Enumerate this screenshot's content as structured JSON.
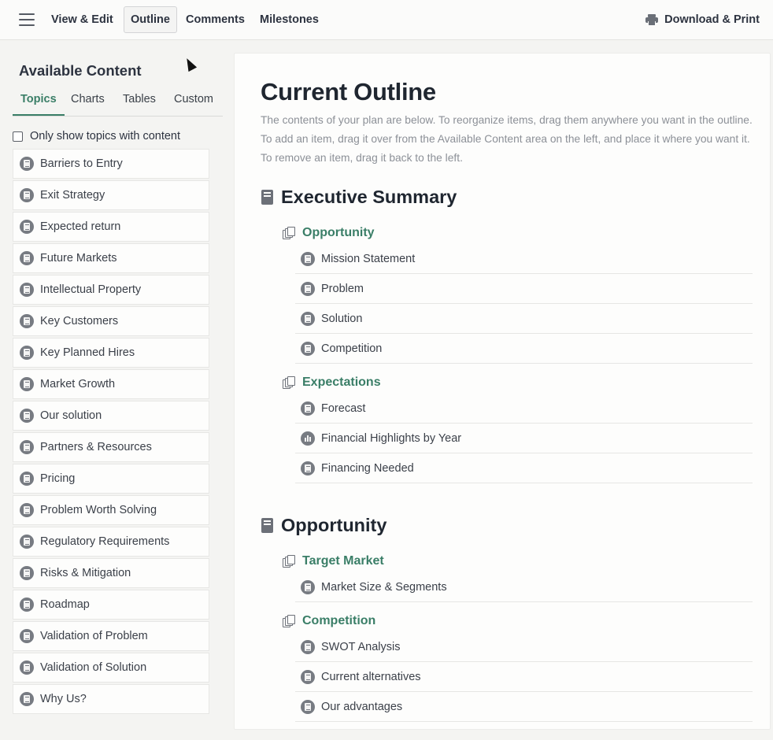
{
  "topbar": {
    "tabs": [
      {
        "label": "View & Edit"
      },
      {
        "label": "Outline",
        "active": true
      },
      {
        "label": "Comments"
      },
      {
        "label": "Milestones"
      }
    ],
    "download_label": "Download & Print"
  },
  "left": {
    "title": "Available Content",
    "tabs": [
      {
        "label": "Topics",
        "active": true
      },
      {
        "label": "Charts"
      },
      {
        "label": "Tables"
      },
      {
        "label": "Custom"
      }
    ],
    "filter_label": "Only show topics with content",
    "filter_checked": false,
    "topics": [
      "Barriers to Entry",
      "Exit Strategy",
      "Expected return",
      "Future Markets",
      "Intellectual Property",
      "Key Customers",
      "Key Planned Hires",
      "Market Growth",
      "Our solution",
      "Partners & Resources",
      "Pricing",
      "Problem Worth Solving",
      "Regulatory Requirements",
      "Risks & Mitigation",
      "Roadmap",
      "Validation of Problem",
      "Validation of Solution",
      "Why Us?"
    ]
  },
  "outline": {
    "title": "Current Outline",
    "description": "The contents of your plan are below. To reorganize items, drag them anywhere you want in the outline. To add an item, drag it over from the Available Content area on the left, and place it where you want it. To remove an item, drag it back to the left.",
    "sections": [
      {
        "title": "Executive Summary",
        "groups": [
          {
            "title": "Opportunity",
            "items": [
              {
                "label": "Mission Statement",
                "icon": "document-icon"
              },
              {
                "label": "Problem",
                "icon": "document-icon"
              },
              {
                "label": "Solution",
                "icon": "document-icon"
              },
              {
                "label": "Competition",
                "icon": "document-icon"
              }
            ]
          },
          {
            "title": "Expectations",
            "items": [
              {
                "label": "Forecast",
                "icon": "document-icon"
              },
              {
                "label": "Financial Highlights by Year",
                "icon": "chart-icon"
              },
              {
                "label": "Financing Needed",
                "icon": "document-icon"
              }
            ]
          }
        ]
      },
      {
        "title": "Opportunity",
        "groups": [
          {
            "title": "Target Market",
            "items": [
              {
                "label": "Market Size & Segments",
                "icon": "document-icon"
              }
            ]
          },
          {
            "title": "Competition",
            "items": [
              {
                "label": "SWOT Analysis",
                "icon": "document-icon"
              },
              {
                "label": "Current alternatives",
                "icon": "document-icon"
              },
              {
                "label": "Our advantages",
                "icon": "document-icon"
              }
            ]
          }
        ]
      }
    ]
  },
  "colors": {
    "accent": "#3a7e67",
    "text": "#2d3340",
    "muted": "#8c9097",
    "icon": "#777b82"
  }
}
